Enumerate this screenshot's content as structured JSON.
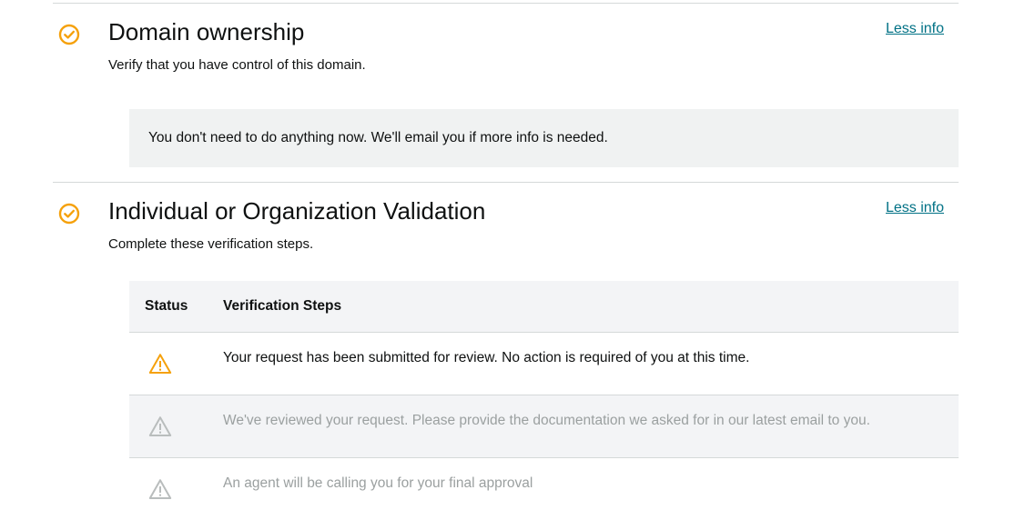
{
  "sections": [
    {
      "title": "Domain ownership",
      "subtitle": "Verify that you have control of this domain.",
      "toggle_label": "Less info",
      "status_icon": "check-circle-icon",
      "notice": "You don't need to do anything now. We'll email you if more info is needed."
    },
    {
      "title": "Individual or Organization Validation",
      "subtitle": "Complete these verification steps.",
      "toggle_label": "Less info",
      "status_icon": "check-circle-icon"
    }
  ],
  "table": {
    "headers": {
      "status": "Status",
      "steps": "Verification Steps"
    },
    "rows": [
      {
        "status_icon": "warning-icon",
        "state": "active",
        "text": "Your request has been submitted for review. No action is required of you at this time."
      },
      {
        "status_icon": "warning-icon",
        "state": "inactive",
        "text": "We've reviewed your request. Please provide the documentation we asked for in our latest email to you."
      },
      {
        "status_icon": "warning-icon",
        "state": "inactive",
        "text": "An agent will be calling you for your final approval"
      }
    ]
  },
  "colors": {
    "accent_orange": "#f5a10c",
    "link": "#007185",
    "muted_text": "#9ba0a0",
    "inactive_icon": "#b9bdbd",
    "divider": "#d5d9d9",
    "panel_bg": "#f0f2f2"
  }
}
